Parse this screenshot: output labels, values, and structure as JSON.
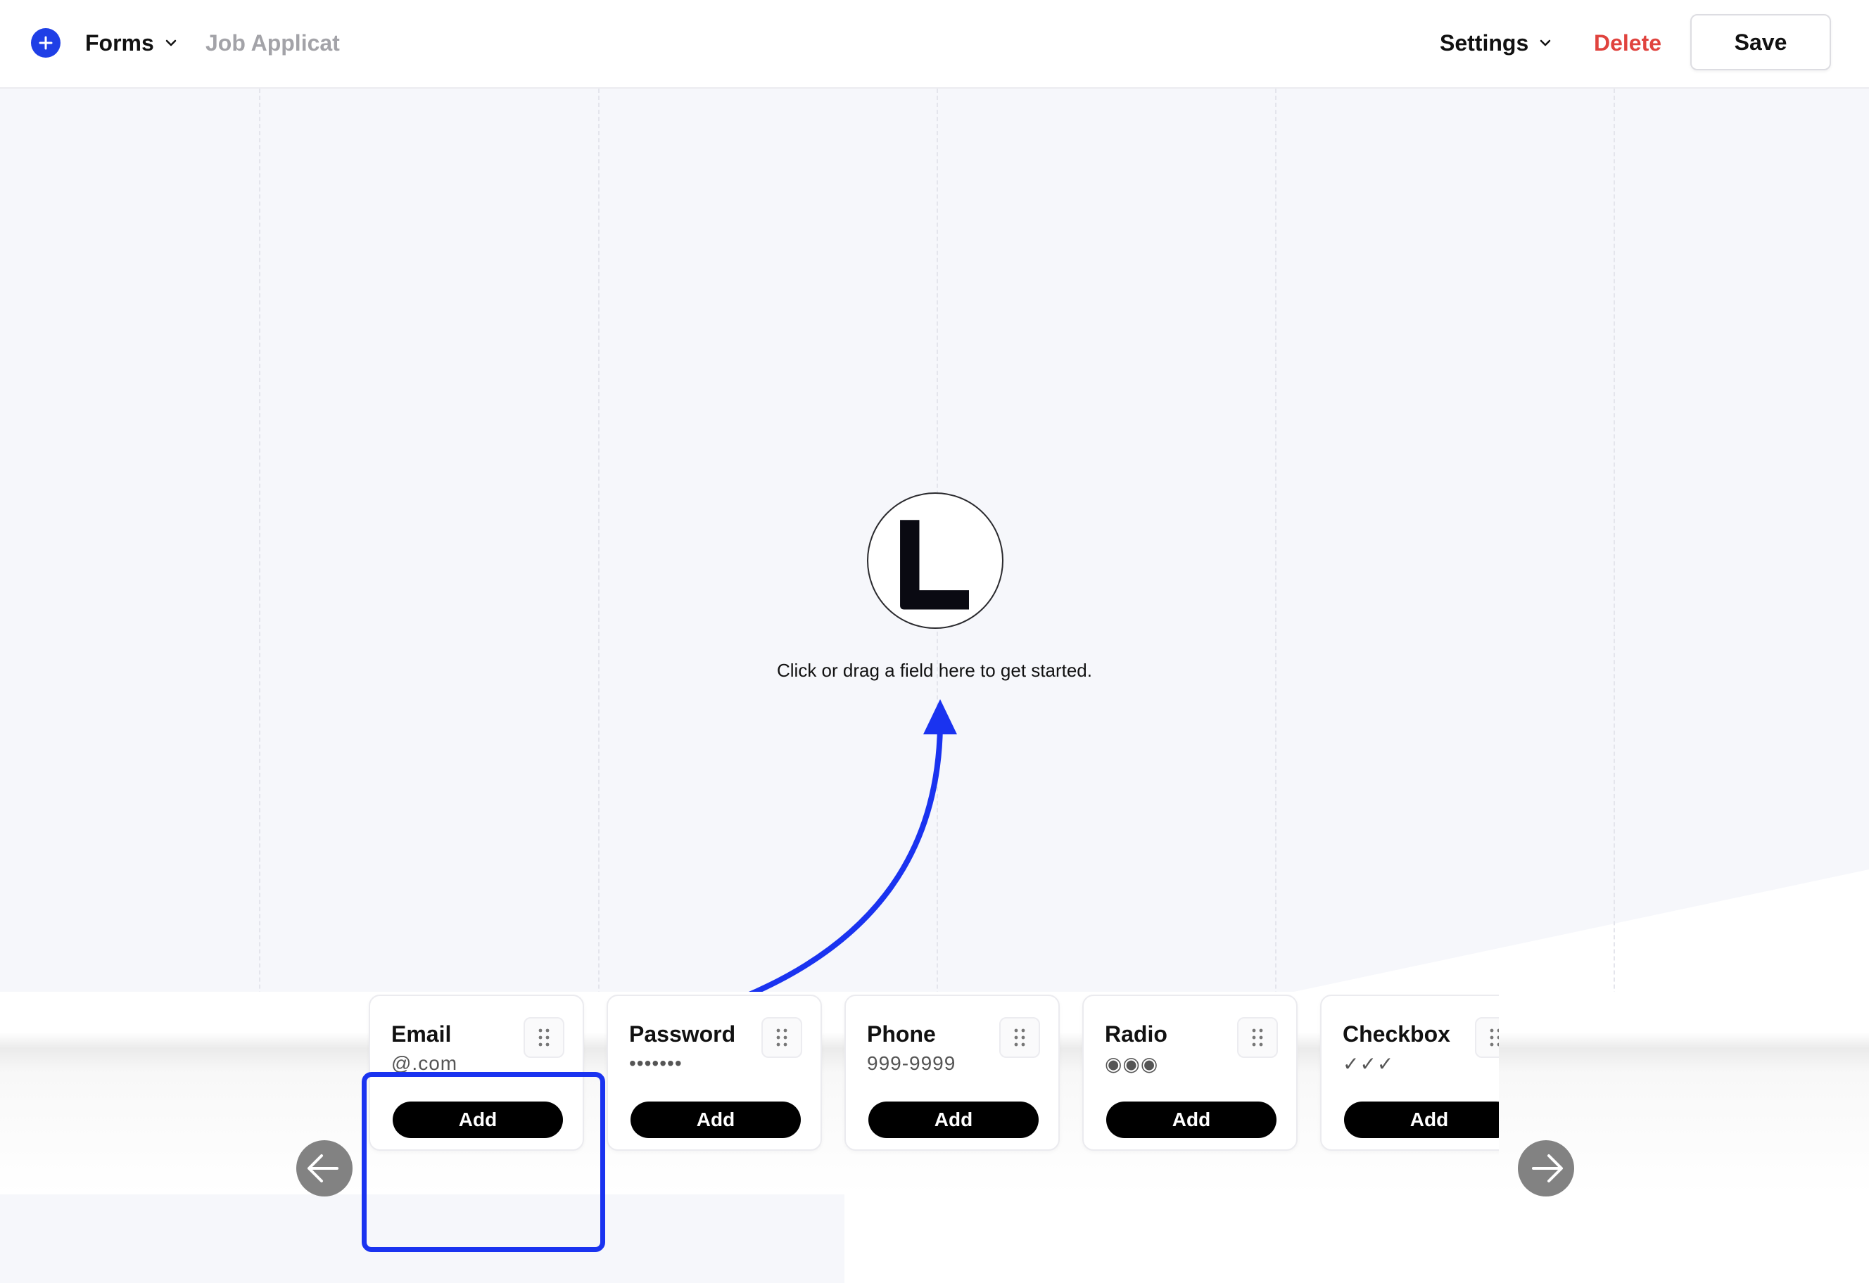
{
  "header": {
    "add_icon": "plus-circle-icon",
    "forms_label": "Forms",
    "form_name": "Job Applicat",
    "settings_label": "Settings",
    "delete_label": "Delete",
    "save_label": "Save"
  },
  "canvas": {
    "logo_letter": "L",
    "empty_message": "Click or drag a field here to get started."
  },
  "palette": {
    "fields": [
      {
        "title": "Email",
        "sample": "@.com",
        "add_label": "Add"
      },
      {
        "title": "Password",
        "sample": "•••••••",
        "add_label": "Add"
      },
      {
        "title": "Phone",
        "sample": "999-9999",
        "add_label": "Add"
      },
      {
        "title": "Radio",
        "sample": "◉◉◉",
        "add_label": "Add"
      },
      {
        "title": "Checkbox",
        "sample": "✓✓✓",
        "add_label": "Add"
      }
    ],
    "prev_icon": "arrow-left-icon",
    "next_icon": "arrow-right-icon"
  },
  "colors": {
    "accent": "#1f3fe6",
    "highlight": "#1a33f0",
    "danger": "#e0433e",
    "canvas_bg": "#f6f7fb"
  }
}
